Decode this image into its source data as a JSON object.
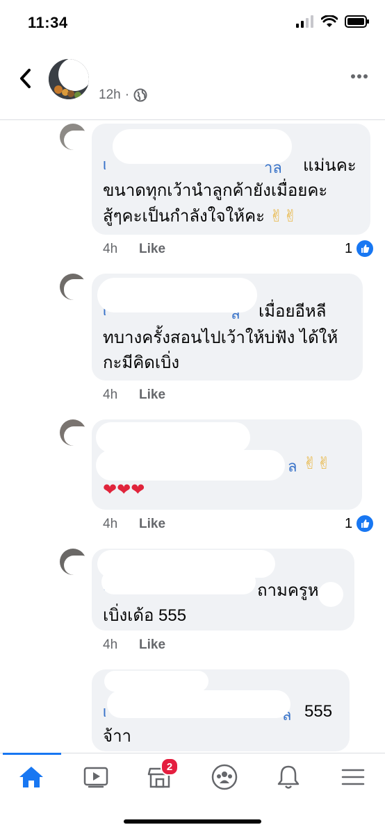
{
  "status_bar": {
    "time": "11:34"
  },
  "post_header": {
    "timestamp": "12h",
    "audience_icon": "globe-icon"
  },
  "comments": [
    {
      "text_line1_tail": "แม่นคะ",
      "text_line2": "ขนาดทุกเว้านำลูกค้ายังเมื่อยคะ",
      "text_line3": "สู้ๆคะเป็นกำลังใจให้คะ",
      "emojis": "✌✌",
      "time": "4h",
      "like_label": "Like",
      "reaction_count": "1"
    },
    {
      "text_line1_tail": "เมื่อยอีหลี",
      "text_line2": "ทบางครั้งสอนไปเว้าให้บ่ฟัง ได้ให้",
      "text_line3": "กะมีคิดเบิ่ง",
      "time": "4h",
      "like_label": "Like"
    },
    {
      "emojis_line1": "✌✌",
      "emojis_line2": "❤❤❤",
      "time": "4h",
      "like_label": "Like",
      "reaction_count": "1"
    },
    {
      "text_line1_tail": "ถามครูห",
      "text_line2": "เบิ่งเด้อ 555",
      "time": "4h",
      "like_label": "Like"
    },
    {
      "text_line1_tail": "555",
      "text_line2": "จ้าา"
    }
  ],
  "tab_bar": {
    "items": [
      "home-icon",
      "watch-icon",
      "marketplace-icon",
      "groups-icon",
      "notifications-icon",
      "menu-icon"
    ],
    "marketplace_badge": "2"
  },
  "colors": {
    "accent": "#1877f2",
    "bubble": "#f0f2f5",
    "muted": "#65676b",
    "badge": "#e41e3f"
  }
}
